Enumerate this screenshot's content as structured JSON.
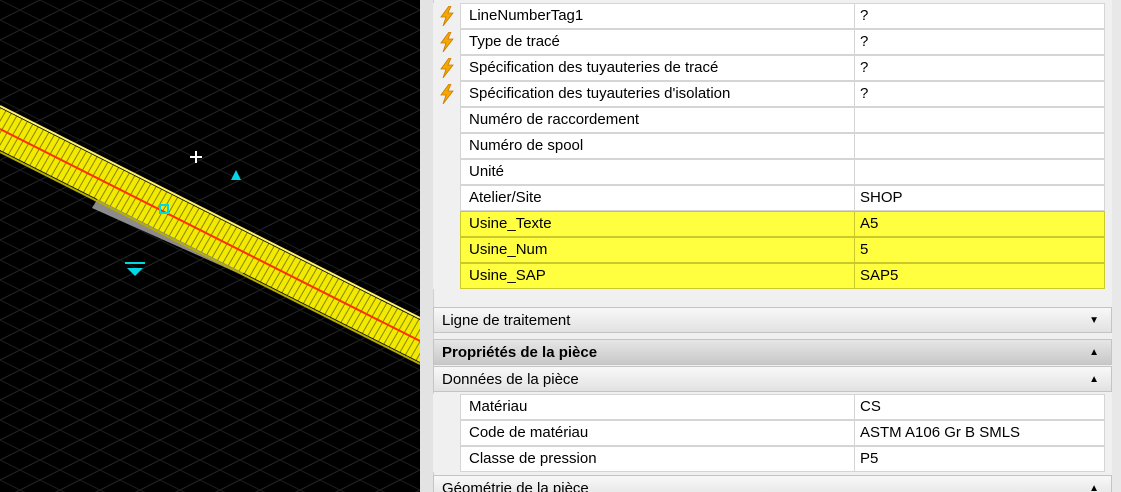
{
  "properties_top": [
    {
      "name": "LineNumberTag1",
      "value": "?",
      "icon": "lightning-icon",
      "highlight": false
    },
    {
      "name": "Type de tracé",
      "value": "?",
      "icon": "lightning-icon",
      "highlight": false
    },
    {
      "name": "Spécification des tuyauteries de tracé",
      "value": "?",
      "icon": "lightning-icon",
      "highlight": false
    },
    {
      "name": "Spécification des tuyauteries d'isolation",
      "value": "?",
      "icon": "lightning-icon",
      "highlight": false
    },
    {
      "name": "Numéro de raccordement",
      "value": "",
      "icon": "",
      "highlight": false
    },
    {
      "name": "Numéro de spool",
      "value": "",
      "icon": "",
      "highlight": false
    },
    {
      "name": "Unité",
      "value": "",
      "icon": "",
      "highlight": false
    },
    {
      "name": "Atelier/Site",
      "value": "SHOP",
      "icon": "",
      "highlight": false
    },
    {
      "name": "Usine_Texte",
      "value": "A5",
      "icon": "",
      "highlight": true
    },
    {
      "name": "Usine_Num",
      "value": "5",
      "icon": "",
      "highlight": true
    },
    {
      "name": "Usine_SAP",
      "value": "SAP5",
      "icon": "",
      "highlight": true
    }
  ],
  "sections": {
    "ligne_traitement": {
      "label": "Ligne de traitement",
      "state": "collapsed",
      "arrow_icon": "triangle-down-icon"
    },
    "proprietes_piece": {
      "label": "Propriétés de la pièce",
      "state": "expanded",
      "arrow_icon": "triangle-up-icon"
    },
    "donnees_piece": {
      "label": "Données de la pièce",
      "state": "expanded",
      "arrow_icon": "triangle-up-icon"
    },
    "geometrie_piece": {
      "label": "Géométrie de la pièce",
      "state": "expanded",
      "arrow_icon": "triangle-up-icon"
    }
  },
  "properties_piece": [
    {
      "name": "Matériau",
      "value": "CS"
    },
    {
      "name": "Code de matériau",
      "value": "ASTM A106 Gr B SMLS"
    },
    {
      "name": "Classe de pression",
      "value": "P5"
    }
  ],
  "arrows": {
    "down": "▼",
    "up": "▲"
  },
  "colors": {
    "highlight": "#ffff40",
    "pipe": "#e8e000",
    "centerline": "#ff3000",
    "grip": "#00d8e8",
    "viewport_bg": "#000000",
    "grid_line": "#2a2a2a"
  }
}
